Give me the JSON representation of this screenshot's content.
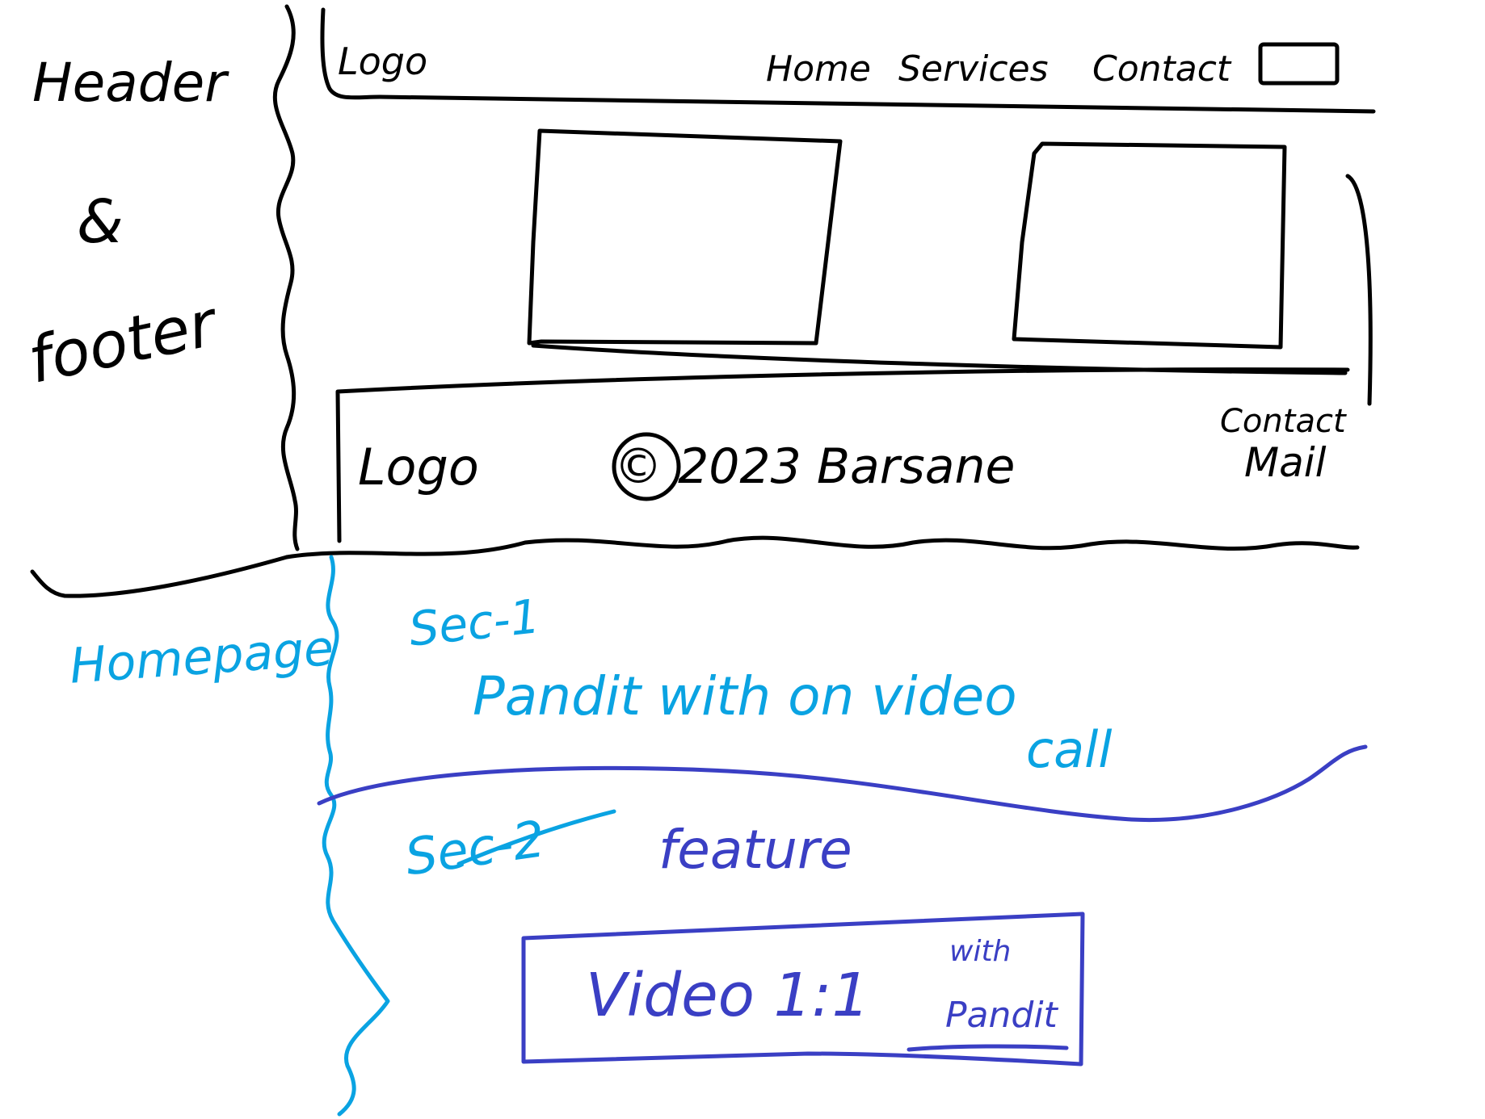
{
  "sketch": {
    "side_label": {
      "line1": "Header",
      "line2": "&",
      "line3": "footer"
    },
    "header": {
      "logo": "Logo",
      "nav": [
        "Home",
        "Services",
        "Contact"
      ]
    },
    "footer": {
      "logo": "Logo",
      "copyright": "© 2023 Barsane",
      "contact_line1": "Contact",
      "contact_line2": "Mail"
    },
    "homepage": {
      "label": "Homepage",
      "sec1": {
        "title": "Sec-1",
        "line1": "Pandit with on video",
        "line2": "call"
      },
      "sec2": {
        "title": "Sec-2",
        "feature": "feature",
        "box_main": "Video 1:1",
        "box_sub1": "with",
        "box_sub2": "Pandit"
      }
    },
    "colors": {
      "ink": "#000000",
      "light_blue": "#0aa3e2",
      "dark_blue": "#3a3fc4"
    }
  }
}
